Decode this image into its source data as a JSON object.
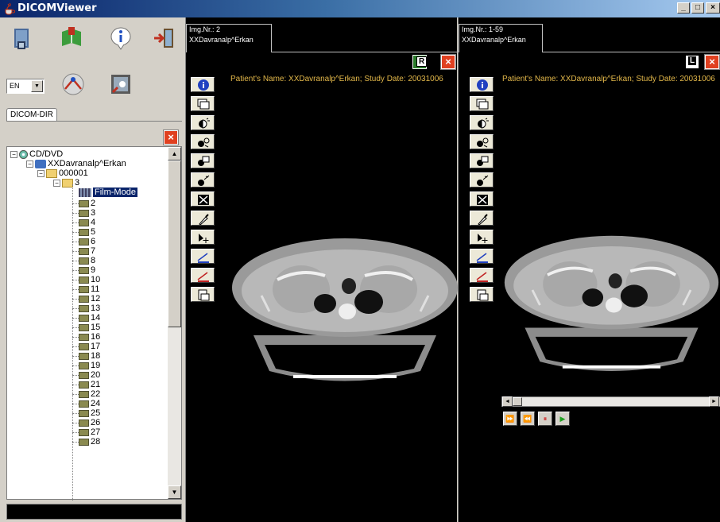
{
  "window": {
    "title": "DICOMViewer",
    "minimize": "_",
    "maximize": "□",
    "close": "×"
  },
  "toolbar": {
    "icons": [
      "open-folder-icon",
      "book-icon",
      "info-icon",
      "exit-icon",
      "network-icon",
      "settings-icon"
    ],
    "language": "EN"
  },
  "left": {
    "tab": "DICOM-DIR",
    "tree": {
      "root": "CD/DVD",
      "patient": "XXDavranalp^Erkan",
      "study": "000001",
      "series": "3",
      "selected": "Film-Mode",
      "images": [
        "2",
        "3",
        "4",
        "5",
        "6",
        "7",
        "8",
        "9",
        "10",
        "11",
        "12",
        "13",
        "14",
        "15",
        "16",
        "17",
        "18",
        "19",
        "20",
        "21",
        "22",
        "24",
        "25",
        "26",
        "27",
        "28"
      ]
    }
  },
  "viewer1": {
    "img_nr": "Img.Nr.: 2",
    "patient": "XXDavranalp^Erkan",
    "info": "Patient's Name: XXDavranalp^Erkan; Study Date: 20031006",
    "corner_label": "R"
  },
  "viewer2": {
    "img_nr": "Img.Nr.: 1-59",
    "patient": "XXDavranalp^Erkan",
    "info": "Patient's Name: XXDavranalp^Erkan; Study Date: 20031006",
    "corner_label": "L",
    "play_buttons": [
      "⏩",
      "⏪",
      "⏸",
      "▶"
    ]
  },
  "colors": {
    "accent": "#0a246a",
    "info_text": "#e3b84a",
    "close": "#e04020",
    "play": "#20a020",
    "pause": "#d02020"
  }
}
